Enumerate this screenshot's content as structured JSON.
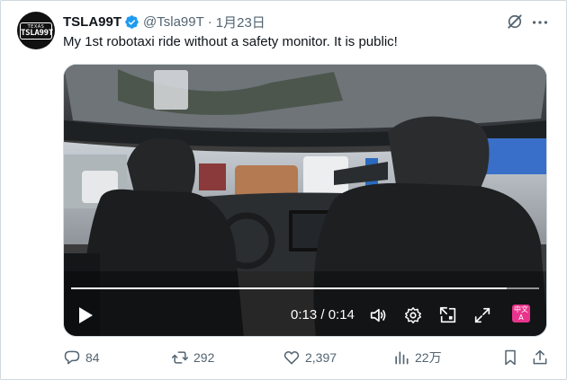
{
  "author": {
    "avatar_top": "TEXAS",
    "avatar_plate": "TSLA99T",
    "display_name": "TSLA99T",
    "handle": "@Tsla99T",
    "separator": "·",
    "date": "1月23日"
  },
  "tweet_text": "My 1st robotaxi ride without a safety monitor. It is public!",
  "video": {
    "time_display": "0:13 / 0:14",
    "progress_fraction": 0.93,
    "cc_label_top": "中文",
    "cc_label_bottom": "A"
  },
  "actions": {
    "replies": "84",
    "reposts": "292",
    "likes": "2,397",
    "views": "22万"
  },
  "colors": {
    "verified_blue": "#1d9bf0",
    "secondary_text": "#536471",
    "cc_pink": "#e8348c"
  },
  "icons": [
    "verified-icon",
    "grok-icon",
    "more-icon",
    "play-icon",
    "volume-icon",
    "settings-icon",
    "pip-icon",
    "fullscreen-icon",
    "reply-icon",
    "repost-icon",
    "like-icon",
    "views-icon",
    "bookmark-icon",
    "share-icon"
  ]
}
